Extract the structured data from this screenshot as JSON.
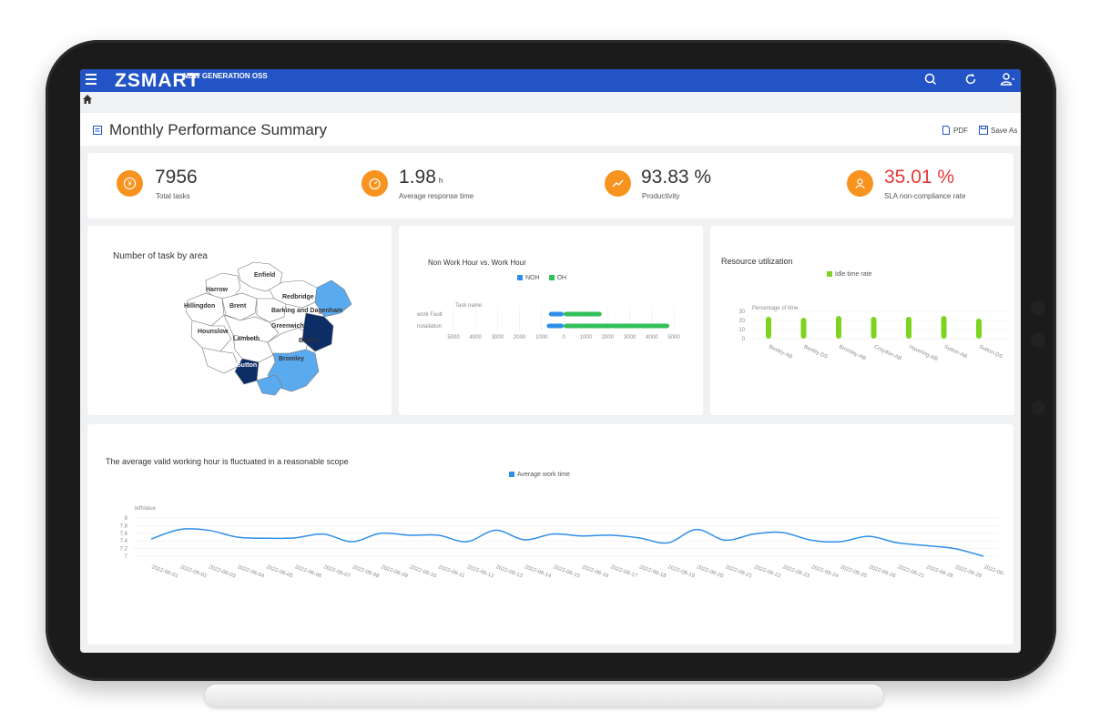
{
  "app": {
    "logo": "ZSMART",
    "logo_sub": "NEW GENERATION OSS",
    "brand_color": "#2254c6",
    "icons": [
      "menu-icon",
      "search-icon",
      "refresh-icon",
      "user-icon",
      "home-icon"
    ]
  },
  "page": {
    "title": "Monthly Performance Summary",
    "actions": {
      "pdf_label": "PDF",
      "save_label": "Save As"
    }
  },
  "kpis": [
    {
      "value": "7956",
      "unit": "",
      "label": "Total tasks",
      "icon": "coin-icon"
    },
    {
      "value": "1.98",
      "unit": "h",
      "label": "Average response time",
      "icon": "speedometer-icon"
    },
    {
      "value": "93.83 %",
      "unit": "",
      "label": "Productivity",
      "icon": "trend-icon"
    },
    {
      "value": "35.01 %",
      "unit": "",
      "label": "SLA non-compliance rate",
      "icon": "person-icon",
      "value_color": "#e53935"
    }
  ],
  "map_panel": {
    "title": "Number of task by area",
    "labels": [
      "Enfield",
      "Harrow",
      "Redbridge",
      "Hillingdon",
      "Brent",
      "Barking and Dagenham",
      "Hounslow",
      "Greenwich",
      "Lambeth",
      "Bexley",
      "Sutton",
      "Bromley"
    ]
  },
  "chart_data": [
    {
      "type": "bar",
      "orientation": "horizontal",
      "title": "Non Work Hour vs. Work Hour",
      "axis_name": "Task name",
      "categories": [
        "work Fault",
        "nstallation"
      ],
      "series": [
        {
          "name": "NOH",
          "values": [
            700,
            800
          ],
          "direction": "left"
        },
        {
          "name": "OH",
          "values": [
            1800,
            5000
          ],
          "direction": "right"
        }
      ],
      "x_ticks": [
        "5000",
        "4000",
        "3000",
        "2000",
        "1000",
        "0",
        "1000",
        "2000",
        "3000",
        "4000",
        "5000"
      ],
      "colors": {
        "NOH": "#2f8fe8",
        "OH": "#33c05a"
      }
    },
    {
      "type": "bar",
      "title": "Resource utilization",
      "ylabel": "Percentage  of time",
      "categories": [
        "Bexley-AB",
        "Bexley-DS",
        "Bromley-AB",
        "Croydon-AB",
        "Havering-AB",
        "Sutton-AB",
        "Sutton-DS"
      ],
      "series": [
        {
          "name": "Idle time rate",
          "values": [
            24,
            23,
            25,
            24,
            24,
            25,
            22
          ]
        }
      ],
      "y_ticks": [
        "30",
        "20",
        "10",
        "0"
      ],
      "ylim": [
        0,
        30
      ],
      "color": "#7ed321"
    },
    {
      "type": "line",
      "title": "The average valid working hour is fluctuated in a reasonable scope",
      "ylabel": "leftValue",
      "ylim": [
        7,
        8
      ],
      "y_ticks": [
        "8",
        "7.8",
        "7.6",
        "7.4",
        "7.2",
        "7"
      ],
      "series": [
        {
          "name": "Average work time",
          "x": [
            "2022-06-01",
            "2022-06-02",
            "2022-06-03",
            "2022-06-04",
            "2022-06-05",
            "2022-06-06",
            "2022-06-07",
            "2022-06-08",
            "2022-06-09",
            "2022-06-10",
            "2022-06-11",
            "2022-06-12",
            "2022-06-13",
            "2022-06-14",
            "2022-06-15",
            "2022-06-16",
            "2022-06-17",
            "2022-06-18",
            "2022-06-19",
            "2022-06-20",
            "2022-06-21",
            "2022-06-22",
            "2022-06-23",
            "2022-06-24",
            "2022-06-25",
            "2022-06-26",
            "2022-06-21",
            "2022-06-28",
            "2022-06-29",
            "2022-06-"
          ],
          "values": [
            7.45,
            7.7,
            7.68,
            7.5,
            7.47,
            7.48,
            7.58,
            7.38,
            7.6,
            7.55,
            7.55,
            7.38,
            7.68,
            7.43,
            7.58,
            7.53,
            7.55,
            7.48,
            7.35,
            7.7,
            7.42,
            7.58,
            7.62,
            7.42,
            7.38,
            7.52,
            7.35,
            7.28,
            7.2,
            7.0
          ]
        }
      ],
      "color": "#2f8fe8"
    }
  ]
}
